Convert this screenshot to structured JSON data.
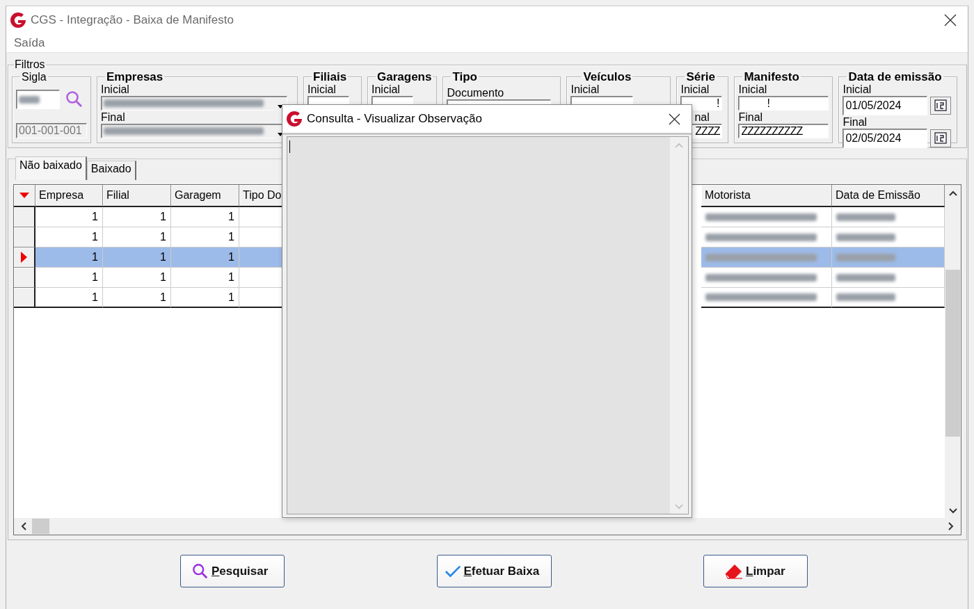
{
  "window": {
    "title": "CGS - Integração - Baixa de Manifesto"
  },
  "menu": [
    "Saída"
  ],
  "filters": {
    "title": "Filtros",
    "sigla": {
      "title": "Sigla",
      "code": "001-001-001"
    },
    "empresas": {
      "title": "Empresas",
      "initial_label": "Inicial",
      "final_label": "Final"
    },
    "filiais": {
      "title": "Filiais",
      "initial_label": "Inicial"
    },
    "garagens": {
      "title": "Garagens",
      "initial_label": "Inicial"
    },
    "tipo": {
      "title": "Tipo",
      "label": "Documento"
    },
    "veiculos": {
      "title": "Veículos",
      "initial_label": "Inicial"
    },
    "serie": {
      "title": "Série",
      "initial_label": "Inicial",
      "initial_value": "!",
      "final_label": "nal",
      "final_value": "ZZZZ"
    },
    "manifesto": {
      "title": "Manifesto",
      "initial_label": "Inicial",
      "initial_value": "!",
      "final_label": "Final",
      "final_value": "ZZZZZZZZZZ"
    },
    "data_emissao": {
      "title": "Data de emissão",
      "initial_label": "Inicial",
      "initial_value": "01/05/2024",
      "final_label": "Final",
      "final_value": "02/05/2024"
    }
  },
  "tabs": [
    {
      "label": "Não baixado",
      "selected": true
    },
    {
      "label": "Baixado",
      "selected": false
    }
  ],
  "table": {
    "columns_left": [
      "Empresa",
      "Filial",
      "Garagem",
      "Tipo Do"
    ],
    "columns_right": [
      "Motorista",
      "Data de Emissão"
    ],
    "rows": [
      {
        "empresa": "1",
        "filial": "1",
        "garagem": "1",
        "selected": false
      },
      {
        "empresa": "1",
        "filial": "1",
        "garagem": "1",
        "selected": false
      },
      {
        "empresa": "1",
        "filial": "1",
        "garagem": "1",
        "selected": true
      },
      {
        "empresa": "1",
        "filial": "1",
        "garagem": "1",
        "selected": false
      },
      {
        "empresa": "1",
        "filial": "1",
        "garagem": "1",
        "selected": false
      }
    ]
  },
  "dialog": {
    "title": "Consulta - Visualizar Observação"
  },
  "buttons": [
    {
      "label": "Pesquisar",
      "kind": "search"
    },
    {
      "label": "Efetuar Baixa",
      "kind": "confirm"
    },
    {
      "label": "Limpar",
      "kind": "clear"
    }
  ]
}
